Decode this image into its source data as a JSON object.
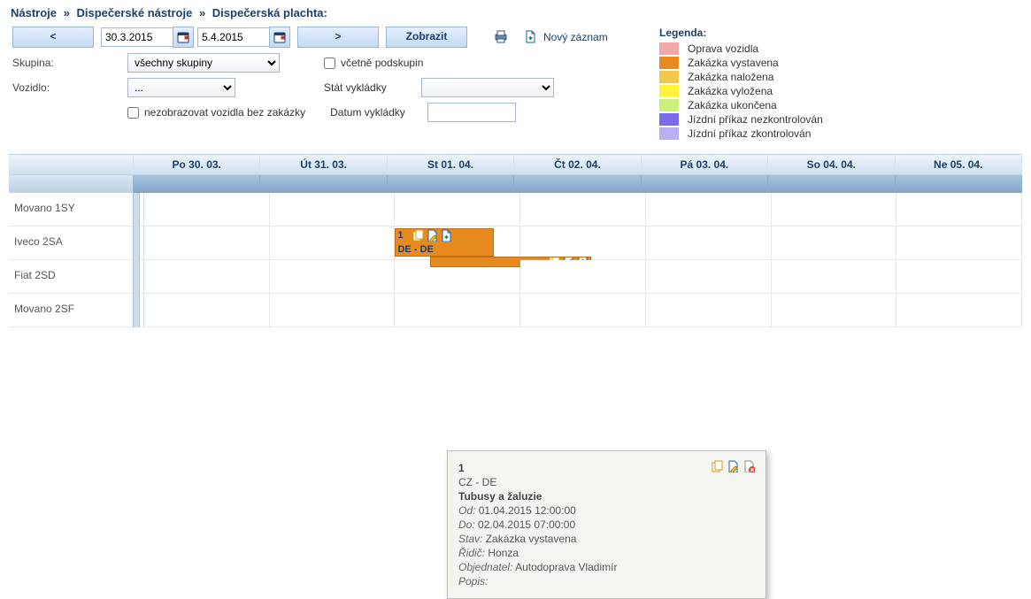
{
  "breadcrumb": {
    "l1": "Nástroje",
    "l2": "Dispečerské nástroje",
    "l3": "Dispečerská plachta:"
  },
  "nav": {
    "prev": "<",
    "next": ">",
    "show": "Zobrazit",
    "newRecord": "Nový záznam"
  },
  "dates": {
    "from": "30.3.2015",
    "to": "5.4.2015"
  },
  "labels": {
    "group": "Skupina:",
    "vehicle": "Vozidlo:",
    "hideEmpty": "nezobrazovat vozidla bez zakázky",
    "includeSub": "včetně podskupin",
    "unloadCountry": "Stát vykládky",
    "unloadDate": "Datum vykládky"
  },
  "selects": {
    "groupAll": "všechny skupiny",
    "vehAll": "...",
    "ctyBlank": ""
  },
  "legend": {
    "title": "Legenda:",
    "items": [
      {
        "color": "#f3a8a8",
        "text": "Oprava vozidla"
      },
      {
        "color": "#e78a1f",
        "text": "Zakázka vystavena"
      },
      {
        "color": "#f2c84b",
        "text": "Zakázka naložena"
      },
      {
        "color": "#fff23a",
        "text": "Zakázka vyložena"
      },
      {
        "color": "#c8f07a",
        "text": "Zakázka ukončena"
      },
      {
        "color": "#7a6be8",
        "text": "Jízdní příkaz nezkontrolován"
      },
      {
        "color": "#b9b0f4",
        "text": "Jízdní příkaz zkontrolován"
      }
    ]
  },
  "planner": {
    "headers": [
      "Po 30. 03.",
      "Út 31. 03.",
      "St 01. 04.",
      "Čt 02. 04.",
      "Pá 03. 04.",
      "So 04. 04.",
      "Ne 05. 04."
    ],
    "vehicles": [
      "Movano 1SY",
      "Iveco 2SA",
      "Fiat 2SD",
      "Movano 2SF"
    ]
  },
  "bar1": {
    "index": "1",
    "route": "DE - DE"
  },
  "tooltip": {
    "index": "1",
    "route": "CZ - DE",
    "title": "Tubusy a žaluzie",
    "odLbl": "Od:",
    "od": "01.04.2015 12:00:00",
    "doLbl": "Do:",
    "do": "02.04.2015 07:00:00",
    "stavLbl": "Stav:",
    "stav": "Zakázka vystavena",
    "ridicLbl": "Řidič:",
    "ridic": "Honza",
    "objLbl": "Objednatel:",
    "obj": "Autodoprava Vladimír",
    "popisLbl": "Popis:"
  }
}
